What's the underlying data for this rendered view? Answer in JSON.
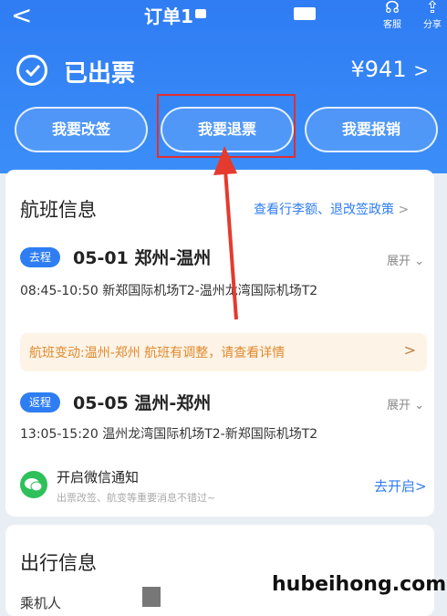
{
  "header": {
    "back_glyph": "<",
    "title": "订单1",
    "service_label": "客服",
    "share_label": "分享"
  },
  "status": {
    "label": "已出票",
    "price": "¥941",
    "price_arrow": ">"
  },
  "actions": {
    "change": "我要改签",
    "refund": "我要退票",
    "reimburse": "我要报销"
  },
  "flight_info": {
    "heading": "航班信息",
    "policy_link": "查看行李额、退改签政策",
    "policy_arrow": ">",
    "outbound": {
      "tag": "去程",
      "route": "05-01 郑州-温州",
      "expand": "展开",
      "detail": "08:45-10:50 新郑国际机场T2-温州龙湾国际机场T2"
    },
    "notice": {
      "text": "航班变动:温州-郑州 航班有调整，请查看详情",
      "chevron": ">"
    },
    "return": {
      "tag": "返程",
      "route": "05-05 温州-郑州",
      "expand": "展开",
      "detail": "13:05-15:20 温州龙湾国际机场T2-新郑国际机场T2"
    },
    "wechat": {
      "title": "开启微信通知",
      "subtitle": "出票改签、航变等重要消息不错过~",
      "button": "去开启>"
    }
  },
  "travel_info": {
    "heading": "出行信息",
    "passenger_label": "乘机人"
  },
  "watermark": "hubeihong.com",
  "colors": {
    "primary": "#2e7df2",
    "highlight": "#e03030",
    "notice_text": "#e08a2e"
  }
}
